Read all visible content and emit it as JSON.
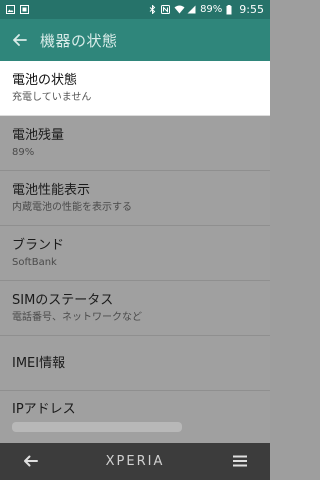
{
  "status_bar": {
    "battery": "89%",
    "time": "9:55"
  },
  "app_bar": {
    "title": "機器の状態"
  },
  "items": [
    {
      "title": "電池の状態",
      "subtitle": "充電していません"
    },
    {
      "title": "電池残量",
      "subtitle": "89%"
    },
    {
      "title": "電池性能表示",
      "subtitle": "内蔵電池の性能を表示する"
    },
    {
      "title": "ブランド",
      "subtitle": "SoftBank"
    },
    {
      "title": "SIMのステータス",
      "subtitle": "電話番号、ネットワークなど"
    },
    {
      "title": "IMEI情報",
      "subtitle": ""
    },
    {
      "title": "IPアドレス",
      "subtitle": ""
    }
  ],
  "nav_bar": {
    "brand": "XPERIA"
  },
  "colors": {
    "status_bar": "#26736a",
    "app_bar": "#2f867b",
    "dim_overlay": "#a0a0a0",
    "nav_bar": "#3c3c3c"
  }
}
